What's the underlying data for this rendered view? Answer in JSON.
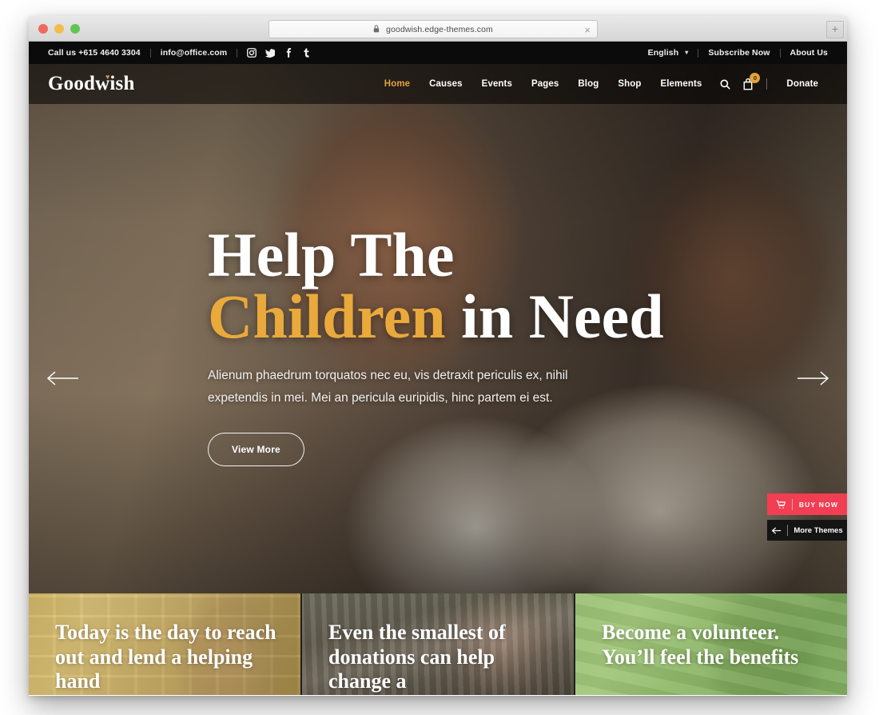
{
  "browser": {
    "url": "goodwish.edge-themes.com",
    "lock_icon": "lock-icon",
    "close_icon": "×",
    "new_tab_label": "+",
    "traffic_lights": [
      "close",
      "minimize",
      "maximize"
    ]
  },
  "top_bar": {
    "phone": "Call us +615 4640 3304",
    "email": "info@office.com",
    "socials": [
      "instagram-icon",
      "twitter-icon",
      "facebook-icon",
      "tumblr-icon"
    ],
    "language": "English",
    "language_caret": "▾",
    "subscribe": "Subscribe Now",
    "about": "About Us"
  },
  "header": {
    "logo": "Goodwish",
    "logo_heart": "♥",
    "nav": [
      {
        "label": "Home",
        "active": true
      },
      {
        "label": "Causes",
        "active": false
      },
      {
        "label": "Events",
        "active": false
      },
      {
        "label": "Pages",
        "active": false
      },
      {
        "label": "Blog",
        "active": false
      },
      {
        "label": "Shop",
        "active": false
      },
      {
        "label": "Elements",
        "active": false
      }
    ],
    "search_icon": "search-icon",
    "cart_icon": "shopping-bag-icon",
    "cart_count": "0",
    "donate": "Donate"
  },
  "hero": {
    "title_line1": "Help The",
    "title_gold": "Children",
    "title_line2_rest": " in Need",
    "subtitle": "Alienum phaedrum torquatos nec eu, vis detraxit periculis ex, nihil expetendis in mei. Mei an pericula euripidis, hinc partem ei est.",
    "cta": "View More",
    "prev_arrow": "arrow-left-icon",
    "next_arrow": "arrow-right-icon",
    "accent_gold": "#e9a93b"
  },
  "promo_widgets": {
    "buy_now": "BUY NOW",
    "buy_now_icon": "cart-icon",
    "buy_now_color": "#f23e52",
    "more_themes": "More Themes",
    "more_themes_icon": "arrow-left-icon"
  },
  "promo_cards": [
    {
      "text": "Today is the day to reach out and lend a helping hand",
      "tint": "#d4bb7b"
    },
    {
      "text": "Even the smallest of donations can help change a",
      "tint": "#7c7568"
    },
    {
      "text": "Become a volunteer. You’ll feel the benefits",
      "tint": "#92ba6c"
    }
  ]
}
